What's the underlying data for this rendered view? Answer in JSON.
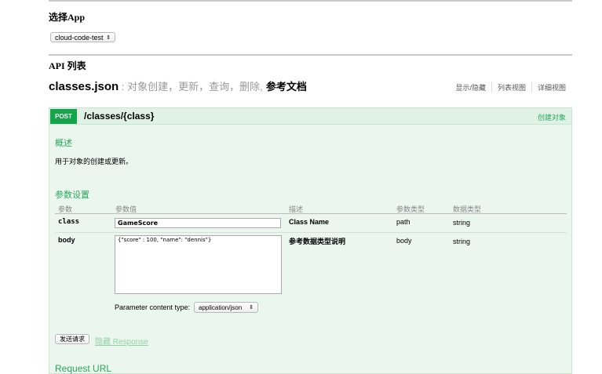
{
  "select_app": {
    "title": "选择App",
    "value": "cloud-code-test"
  },
  "api_list": {
    "title": "API 列表"
  },
  "resource": {
    "name": "classes.json",
    "desc": " : 对象创建，更新，查询，删除,",
    "doc_link": "参考文档",
    "actions": [
      "显示/隐藏",
      "列表视图",
      "详细视图"
    ]
  },
  "operation": {
    "method": "POST",
    "path": "/classes/{class}",
    "summary": "创建对象",
    "overview_title": "概述",
    "overview_text": "用于对象的创建或更新。",
    "params_title": "参数设置",
    "columns": [
      "参数",
      "参数值",
      "描述",
      "参数类型",
      "数据类型"
    ],
    "params": [
      {
        "name": "class",
        "value": "GameScore",
        "desc": "Class Name",
        "param_type": "path",
        "data_type": "string"
      },
      {
        "name": "body",
        "value": "{\"score\" : 100, \"name\": \"dennis\"}",
        "desc": "参考数据类型说明",
        "param_type": "body",
        "data_type": "string"
      }
    ],
    "content_type_label": "Parameter content type:",
    "content_type": "application/json",
    "send_button": "发送请求",
    "hide_response": "隐藏 Response",
    "request_url_title": "Request URL"
  }
}
